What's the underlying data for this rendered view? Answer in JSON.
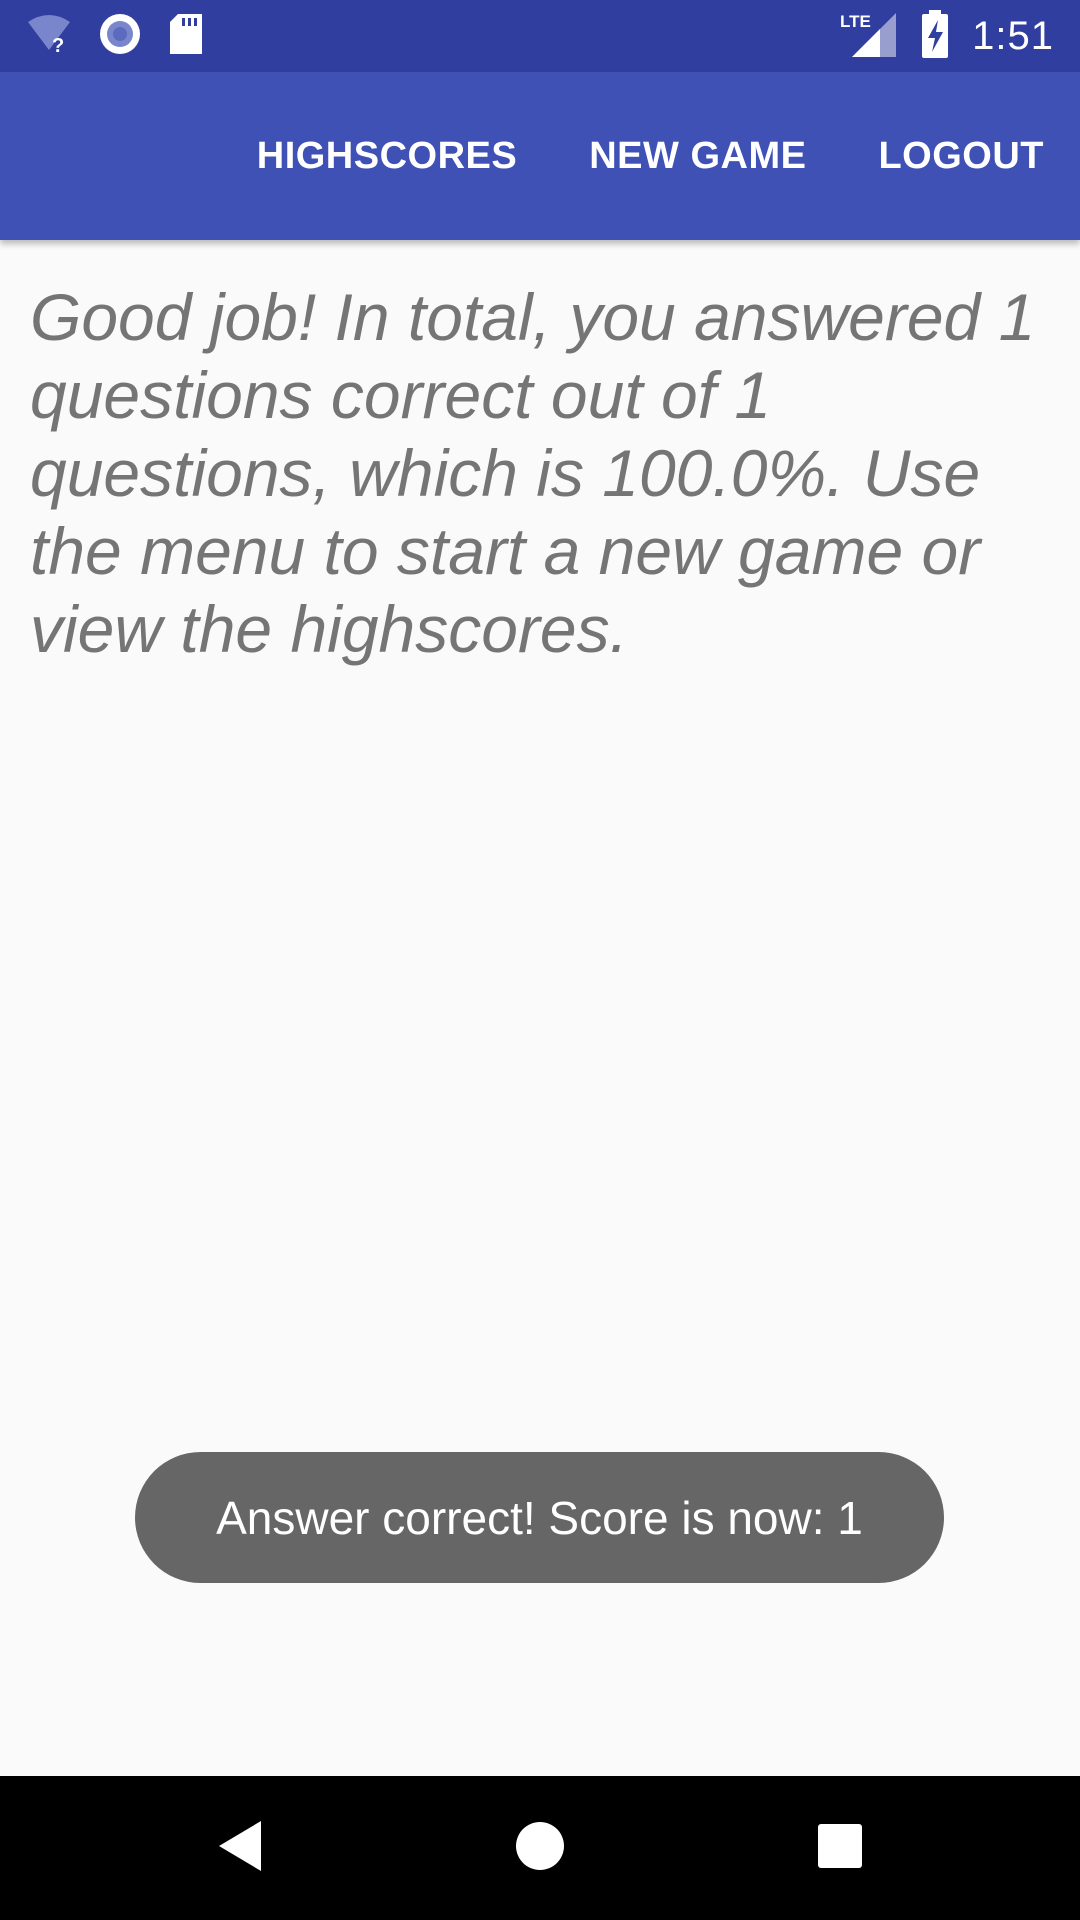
{
  "status_bar": {
    "time": "1:51",
    "network_label": "LTE",
    "icons": [
      "wifi-unknown-icon",
      "sync-circle-icon",
      "sd-card-icon",
      "lte-signal-icon",
      "battery-charging-icon"
    ]
  },
  "app_bar": {
    "menu": [
      {
        "label": "HIGHSCORES"
      },
      {
        "label": "NEW GAME"
      },
      {
        "label": "LOGOUT"
      }
    ]
  },
  "main": {
    "message": "Good job! In total, you answered 1 questions correct out of 1 questions, which is 100.0%. Use the menu to start a new game or view the highscores."
  },
  "toast": {
    "text": "Answer correct! Score is now: 1"
  },
  "nav_bar": {
    "buttons": [
      "back-icon",
      "home-icon",
      "recents-icon"
    ]
  },
  "colors": {
    "status_bar": "#303f9f",
    "app_bar": "#3f51b5",
    "background": "#fafafa",
    "message_text": "#757575",
    "toast_bg": "#666666",
    "nav_bar": "#000000"
  }
}
